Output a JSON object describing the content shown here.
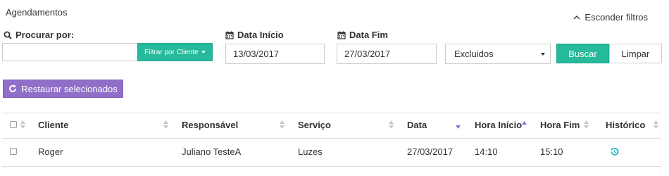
{
  "page": {
    "title": "Agendamentos",
    "toggle_filters_label": "Esconder filtros"
  },
  "filters": {
    "search_label": "Procurar por:",
    "search_value": "",
    "filter_client_label": "Filtrar por Cliente",
    "start_date_label": "Data Início",
    "start_date_value": "13/03/2017",
    "end_date_label": "Data Fim",
    "end_date_value": "27/03/2017",
    "status_select_value": "Excluidos",
    "search_button_label": "Buscar",
    "clear_button_label": "Limpar"
  },
  "actions": {
    "restore_selected_label": "Restaurar selecionados"
  },
  "table": {
    "columns": [
      "Cliente",
      "Responsável",
      "Serviço",
      "Data",
      "Hora Início",
      "Hora Fim",
      "Histórico"
    ],
    "rows": [
      {
        "cliente": "Roger",
        "responsavel": "Juliano TesteA",
        "servico": "Luzes",
        "data": "27/03/2017",
        "hora_inicio": "14:10",
        "hora_fim": "15:10"
      }
    ]
  },
  "colors": {
    "primary_green": "#26b99a",
    "restore_purple": "#8f6fc8",
    "history_icon": "#26b8c9",
    "sort_active": "#7a7ad8",
    "sort_inactive": "#c8c8c8"
  }
}
